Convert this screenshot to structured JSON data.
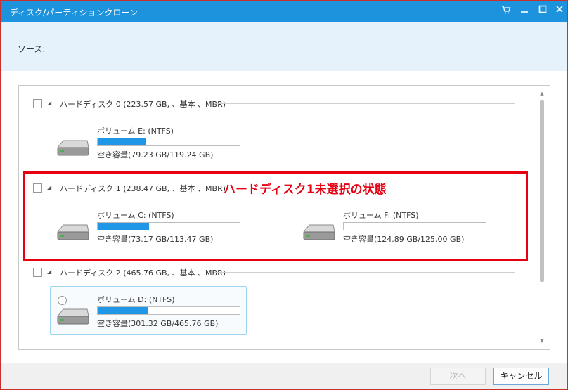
{
  "window": {
    "title": "ディスク/パーティションクローン"
  },
  "source": {
    "label": "ソース:"
  },
  "disks": [
    {
      "label": "ハードディスク 0 (223.57 GB, 、基本 、MBR)",
      "volumes": [
        {
          "name": "ボリューム E: (NTFS)",
          "capacity": "空き容量(79.23 GB/119.24 GB)",
          "free_fraction": 0.66
        }
      ]
    },
    {
      "label": "ハードディスク 1 (238.47 GB, 、基本 、MBR)",
      "volumes": [
        {
          "name": "ボリューム C: (NTFS)",
          "capacity": "空き容量(73.17 GB/113.47 GB)",
          "free_fraction": 0.64
        },
        {
          "name": "ボリューム F: (NTFS)",
          "capacity": "空き容量(124.89 GB/125.00 GB)",
          "free_fraction": 0.999
        }
      ]
    },
    {
      "label": "ハードディスク 2 (465.76 GB, 、基本 、MBR)",
      "volumes": [
        {
          "name": "ボリューム D: (NTFS)",
          "capacity": "空き容量(301.32 GB/465.76 GB)",
          "free_fraction": 0.65
        }
      ]
    }
  ],
  "annotation": {
    "text": "ハードディスク1未選択の状態",
    "color": "#e60012"
  },
  "buttons": {
    "next": "次へ",
    "cancel": "キャンセル"
  },
  "colors": {
    "titlebar": "#1e93dd",
    "bar_fill": "#1f96e6"
  }
}
